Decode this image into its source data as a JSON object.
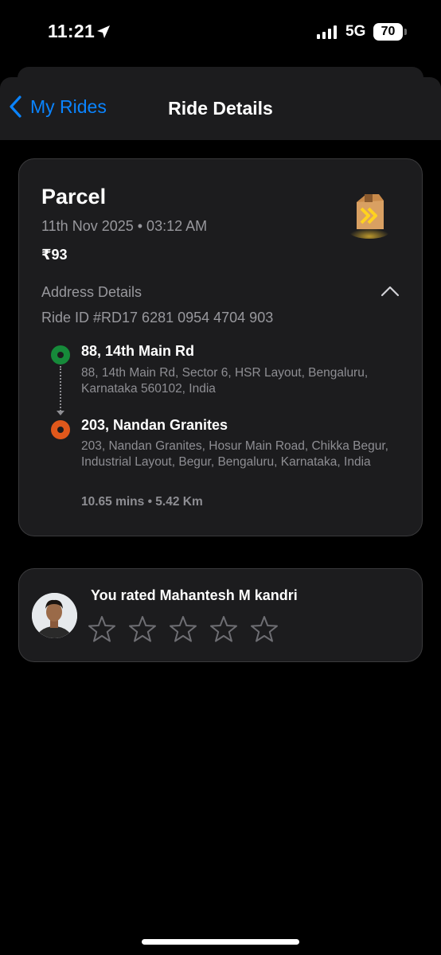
{
  "status_bar": {
    "time": "11:21",
    "network": "5G",
    "battery": "70"
  },
  "nav": {
    "back_label": "My Rides",
    "title": "Ride Details"
  },
  "ride": {
    "service": "Parcel",
    "datetime": "11th Nov 2025 • 03:12 AM",
    "fare": "₹93",
    "address_section_label": "Address Details",
    "ride_id": "Ride ID #RD17 6281 0954 4704 903",
    "pickup": {
      "name": "88, 14th Main Rd",
      "address": "88, 14th Main Rd, Sector 6, HSR Layout, Bengaluru, Karnataka 560102, India"
    },
    "drop": {
      "name": "203, Nandan Granites",
      "address": "203, Nandan Granites, Hosur Main Road, Chikka Begur, Industrial Layout, Begur, Bengaluru, Karnataka, India"
    },
    "trip_stats": "10.65 mins • 5.42 Km"
  },
  "rating": {
    "text": "You rated Mahantesh M kandri",
    "stars_filled": 0,
    "stars_total": 5
  },
  "colors": {
    "accent": "#0a84ff",
    "pickup_dot": "#168a3a",
    "drop_dot": "#e0581b",
    "card_bg": "#1c1c1e"
  },
  "icons": [
    "location-arrow-icon",
    "signal-icon",
    "battery-icon",
    "back-chevron-icon",
    "parcel-box-icon",
    "chevron-up-icon",
    "pickup-dot-icon",
    "drop-dot-icon",
    "star-icon"
  ]
}
